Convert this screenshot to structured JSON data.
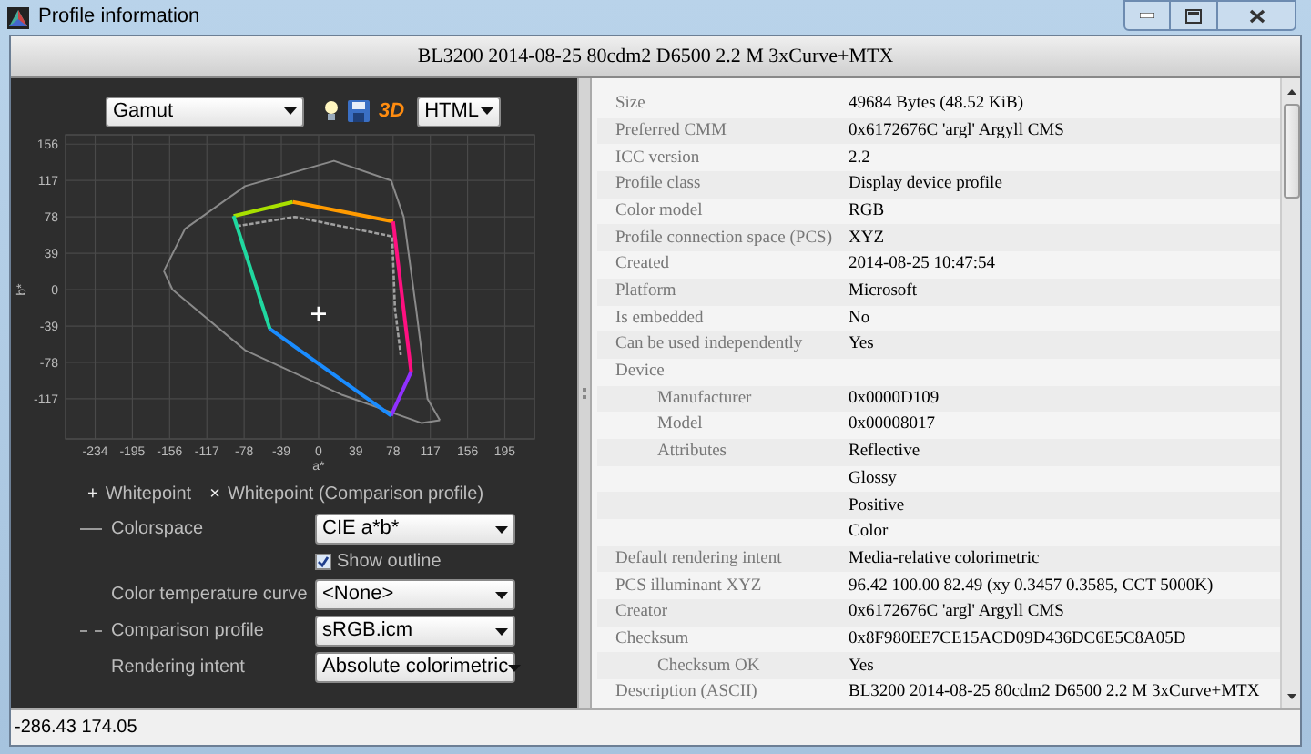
{
  "window": {
    "title": "Profile information"
  },
  "header": {
    "title": "BL3200 2014-08-25 80cdm2 D6500 2.2 M 3xCurve+MTX"
  },
  "toolbar": {
    "view": "Gamut",
    "three_d": "3D",
    "format": "HTML"
  },
  "chart": {
    "chart_data": {
      "type": "line",
      "xlabel": "a*",
      "ylabel": "b*",
      "xlim": [
        -265,
        226
      ],
      "ylim": [
        -160,
        166
      ],
      "xticks": [
        -234,
        -195,
        -156,
        -117,
        -78,
        -39,
        0,
        39,
        78,
        117,
        156,
        195
      ],
      "yticks": [
        156,
        117,
        78,
        39,
        0,
        -39,
        -78,
        -117
      ],
      "grid": true,
      "series": [
        {
          "color": "#8a8a8a",
          "x": [
            -162,
            -140,
            -77,
            16,
            76,
            89,
            102,
            114,
            127
          ],
          "values": [
            20,
            65,
            111,
            138,
            117,
            78,
            -20,
            -117,
            -140
          ]
        },
        {
          "color": "#8a8a8a",
          "x": [
            -162,
            -153,
            -77,
            25,
            108,
            127
          ],
          "values": [
            20,
            0,
            -65,
            -113,
            -143,
            -140
          ]
        },
        {
          "color": "#a0a0a0",
          "line_style": "dashed",
          "x": [
            -86,
            -25,
            77,
            80,
            86
          ],
          "values": [
            68,
            78,
            57,
            -20,
            -70
          ]
        },
        {
          "color": "#a8e000",
          "x": [
            -89,
            -27
          ],
          "values": [
            79,
            94
          ]
        },
        {
          "color": "#ff9a00",
          "x": [
            -27,
            78
          ],
          "values": [
            94,
            73
          ]
        },
        {
          "color": "#ff1080",
          "x": [
            78,
            97
          ],
          "values": [
            73,
            -88
          ]
        },
        {
          "color": "#9030ff",
          "x": [
            76,
            97
          ],
          "values": [
            -135,
            -88
          ]
        },
        {
          "color": "#1a8cff",
          "x": [
            -51,
            76
          ],
          "values": [
            -42,
            -135
          ]
        },
        {
          "color": "#20d8a0",
          "x": [
            -89,
            -51
          ],
          "values": [
            79,
            -42
          ]
        },
        {
          "color": "#ffffff",
          "marker": "cross",
          "x": [
            0
          ],
          "values": [
            -26
          ]
        }
      ]
    }
  },
  "legend": [
    {
      "symbol": "+",
      "label": "Whitepoint"
    },
    {
      "symbol": "×",
      "label": "Whitepoint (Comparison profile)"
    }
  ],
  "settings": [
    {
      "kind": "solid-line",
      "label": "Colorspace",
      "value": "CIE a*b*"
    },
    {
      "kind": "checkbox",
      "label": "Show outline",
      "checked": true
    },
    {
      "kind": "select",
      "label": "Color temperature curve",
      "value": "<None>"
    },
    {
      "kind": "dashed-line",
      "label": "Comparison profile",
      "value": "sRGB.icm"
    },
    {
      "kind": "select",
      "label": "Rendering intent",
      "value": "Absolute colorimetric"
    }
  ],
  "table": {
    "rows": [
      {
        "label": "Size",
        "value": "49684 Bytes (48.52 KiB)"
      },
      {
        "label": "Preferred CMM",
        "value": "0x6172676C 'argl' Argyll CMS"
      },
      {
        "label": "ICC version",
        "value": "2.2"
      },
      {
        "label": "Profile class",
        "value": "Display device profile"
      },
      {
        "label": "Color model",
        "value": "RGB"
      },
      {
        "label": "Profile connection space (PCS)",
        "value": "XYZ"
      },
      {
        "label": "Created",
        "value": "2014-08-25 10:47:54"
      },
      {
        "label": "Platform",
        "value": "Microsoft"
      },
      {
        "label": "Is embedded",
        "value": "No"
      },
      {
        "label": "Can be used independently",
        "value": "Yes"
      },
      {
        "label": "Device",
        "children": [
          {
            "label": "Manufacturer",
            "value": "0x0000D109"
          },
          {
            "label": "Model",
            "value": "0x00008017"
          },
          {
            "label": "Attributes",
            "values": [
              "Reflective",
              "Glossy",
              "Positive",
              "Color"
            ]
          }
        ]
      },
      {
        "label": "Default rendering intent",
        "value": "Media-relative colorimetric"
      },
      {
        "label": "PCS illuminant XYZ",
        "value": "96.42 100.00  82.49 (xy 0.3457 0.3585, CCT 5000K)"
      },
      {
        "label": "Creator",
        "value": "0x6172676C 'argl' Argyll CMS"
      },
      {
        "label": "Checksum",
        "value": "0x8F980EE7CE15ACD09D436DC6E5C8A05D",
        "children": [
          {
            "label": "Checksum OK",
            "value": "Yes"
          }
        ]
      },
      {
        "label": "Description (ASCII)",
        "value": "BL3200 2014-08-25 80cdm2 D6500 2.2 M 3xCurve+MTX"
      }
    ]
  },
  "status_bar": {
    "text": "-286.43 174.05"
  }
}
